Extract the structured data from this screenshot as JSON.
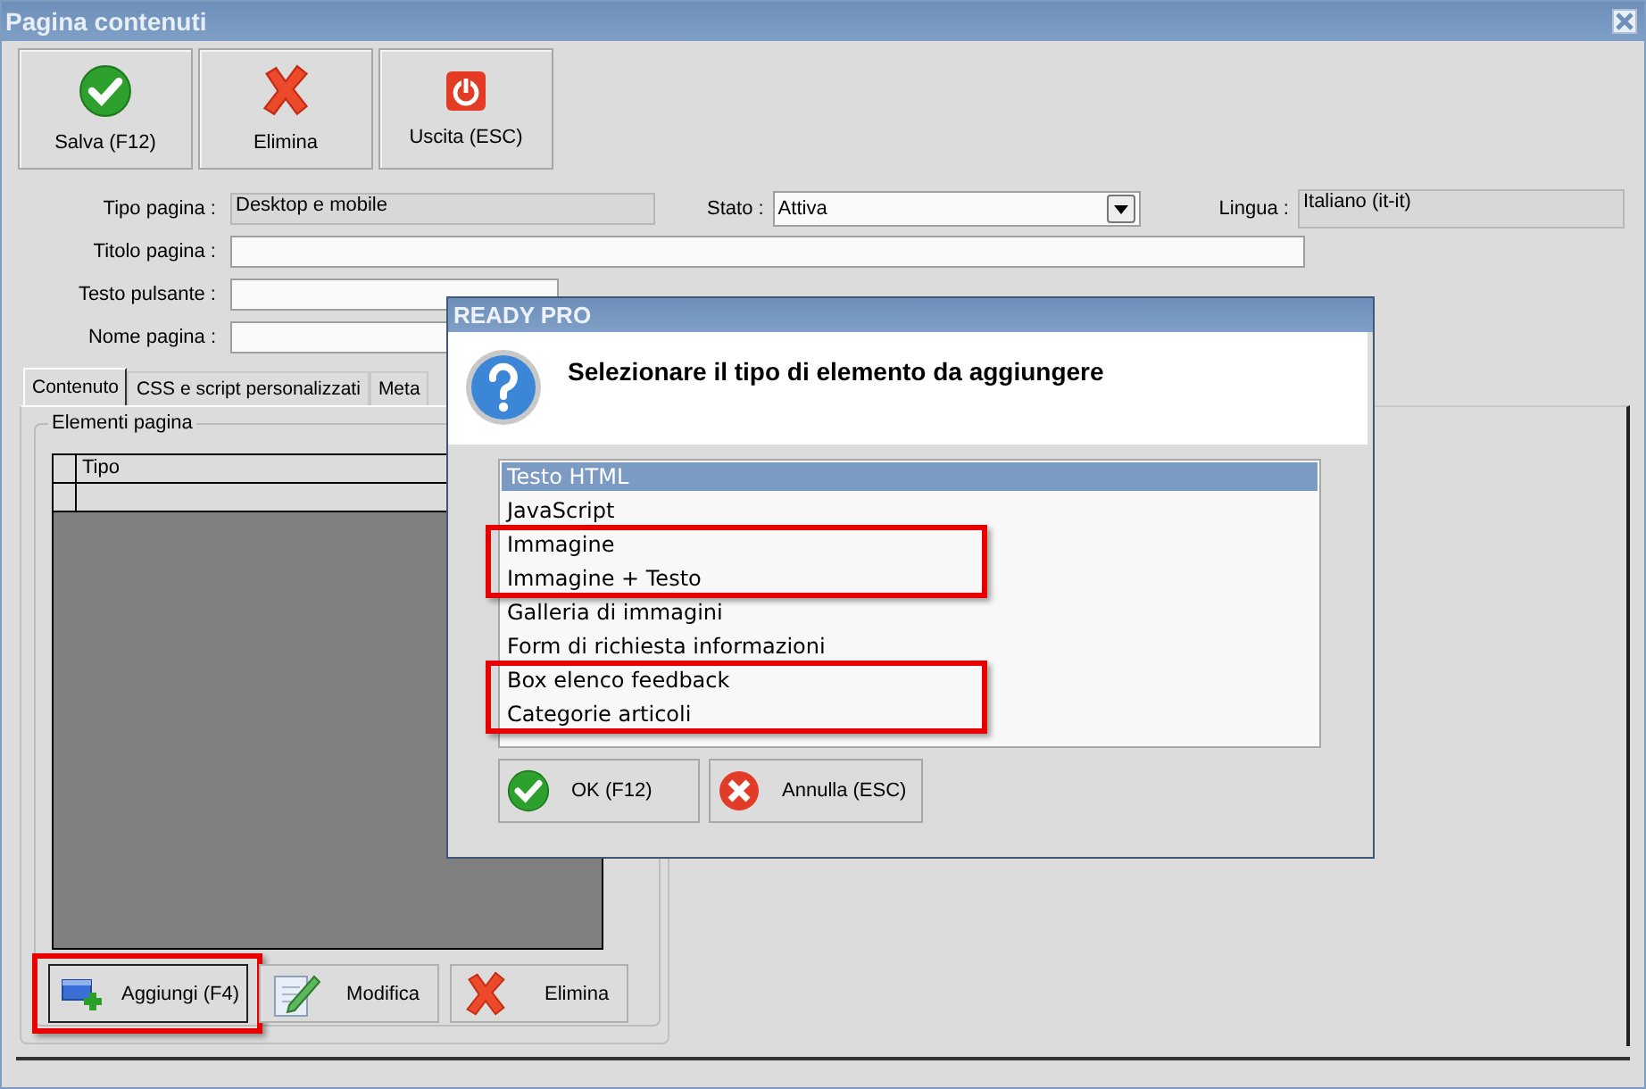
{
  "window": {
    "title": "Pagina contenuti"
  },
  "toolbar": [
    {
      "label": "Salva (F12)",
      "kind": "save"
    },
    {
      "label": "Elimina",
      "kind": "delete"
    },
    {
      "label": "Uscita (ESC)",
      "kind": "exit"
    }
  ],
  "form": {
    "tipo_pagina": {
      "label": "Tipo pagina :",
      "value": "Desktop e mobile",
      "kind": "readonly"
    },
    "stato": {
      "label": "Stato :",
      "value": "Attiva",
      "kind": "combo"
    },
    "lingua": {
      "label": "Lingua :",
      "value": "Italiano (it-it)",
      "kind": "readonly"
    },
    "titolo_pagina": {
      "label": "Titolo pagina :",
      "kind": "text"
    },
    "testo_pulsante": {
      "label": "Testo pulsante :",
      "kind": "text"
    },
    "nome_pagina": {
      "label": "Nome pagina :",
      "kind": "text"
    }
  },
  "tabs": [
    {
      "label": "Contenuto",
      "selected": true
    },
    {
      "label": "CSS e script personalizzati",
      "selected": false
    },
    {
      "label": "Meta",
      "selected": false
    }
  ],
  "group": {
    "title": "Elementi pagina",
    "columns": [
      "Tipo"
    ],
    "buttons": [
      {
        "label": "Aggiungi (F4)",
        "kind": "add",
        "highlighted": true
      },
      {
        "label": "Modifica",
        "kind": "edit",
        "highlighted": false
      },
      {
        "label": "Elimina",
        "kind": "delete",
        "highlighted": false
      }
    ]
  },
  "dialog": {
    "title": "READY PRO",
    "message": "Selezionare il tipo di elemento da aggiungere",
    "items": [
      {
        "label": "Testo HTML",
        "selected": true,
        "highlighted": false
      },
      {
        "label": "JavaScript",
        "selected": false,
        "highlighted": false
      },
      {
        "label": "Immagine",
        "selected": false,
        "highlighted": true
      },
      {
        "label": "Immagine + Testo",
        "selected": false,
        "highlighted": true
      },
      {
        "label": "Galleria di immagini",
        "selected": false,
        "highlighted": false
      },
      {
        "label": "Form di richiesta informazioni",
        "selected": false,
        "highlighted": false
      },
      {
        "label": "Box elenco feedback",
        "selected": false,
        "highlighted": true
      },
      {
        "label": "Categorie articoli",
        "selected": false,
        "highlighted": true
      }
    ],
    "buttons": [
      {
        "label": "OK (F12)",
        "kind": "ok"
      },
      {
        "label": "Annulla (ESC)",
        "kind": "cancel"
      }
    ]
  }
}
